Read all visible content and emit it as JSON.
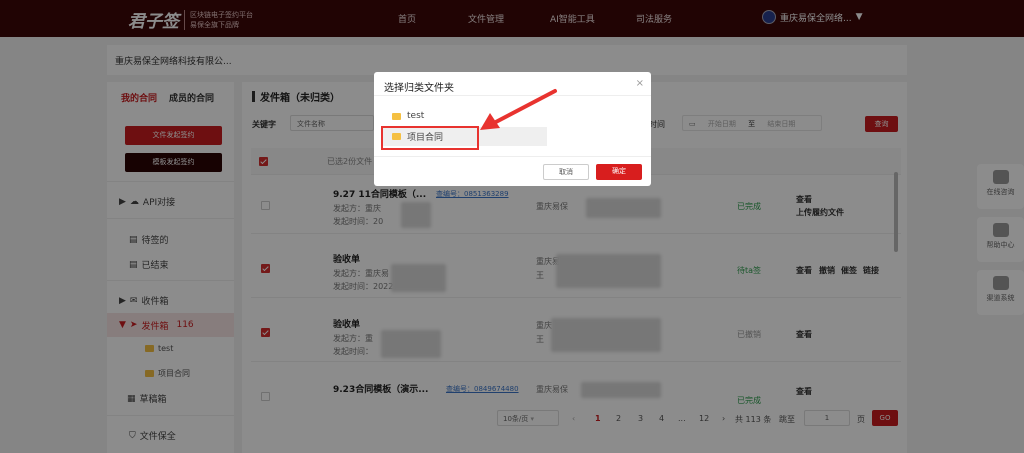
{
  "topbar": {
    "logo_text": "君子签",
    "logo_sub1": "区块链电子签约平台",
    "logo_sub2": "易保全旗下品牌",
    "nav": [
      "首页",
      "文件管理",
      "AI智能工具",
      "司法服务"
    ],
    "account_name": "重庆易保全网络...",
    "dropdown_icon": "chevron-down-icon"
  },
  "company_tab": "重庆易保全网络科技有限公...",
  "sidebar": {
    "tabs": [
      "我的合同",
      "成员的合同"
    ],
    "btn_launch": "文件发起签约",
    "btn_template": "模板发起签约",
    "items": {
      "api": "API对接",
      "pending": "待签的",
      "ended": "已结束",
      "inbox": "收件箱",
      "outbox": "发件箱",
      "outbox_count": "116",
      "sub_test": "test",
      "sub_project": "项目合同",
      "drafts": "草稿箱",
      "preserve": "文件保全"
    }
  },
  "main": {
    "title": "发件箱（未归类）",
    "filter_label": "关键字",
    "filter_select": "文件名称",
    "time_label": "时间",
    "start_date": "开始日期",
    "to": "至",
    "end_date": "结束日期",
    "query_btn": "查询",
    "selected_text": "已选2份文件",
    "rows": [
      {
        "title": "9.27 11合同模板（...",
        "contract_no": "查编号：0851363289",
        "sender": "发起方：重庆",
        "time": "发起时间：20",
        "company": "重庆易保",
        "status": "已完成",
        "status_color": "#2e9d4e",
        "op1": "查看",
        "op2": "上传履约文件"
      },
      {
        "title": "验收单",
        "contract_no": "",
        "sender": "发起方：重庆易",
        "time": "发起时间：2022-",
        "company": "重庆易",
        "company2": "王",
        "status": "待ta签",
        "status_color": "#2e9d4e",
        "op1": "查看",
        "op2": "撤销",
        "op3": "催签",
        "op4": "链接"
      },
      {
        "title": "验收单",
        "contract_no": "",
        "sender": "发起方：重",
        "time": "发起时间：",
        "company": "重庆",
        "company2": "王",
        "status": "已撤销",
        "status_color": "#999999",
        "op1": "查看"
      },
      {
        "title": "9.23合同模板（演示...",
        "contract_no": "查编号：0849674480",
        "sender": "",
        "time": "",
        "company": "重庆易保",
        "status": "已完成",
        "status_color": "#2e9d4e",
        "op1": "查看"
      }
    ]
  },
  "pager": {
    "page_size": "10条/页",
    "pages": [
      "1",
      "2",
      "3",
      "4",
      "...",
      "12"
    ],
    "total": "共 113 条",
    "goto": "跳至",
    "page_input": "1",
    "page_unit": "页",
    "go": "GO"
  },
  "float_panel": {
    "online": "在线咨询",
    "help": "帮助中心",
    "channel": "渠道系统"
  },
  "modal": {
    "title": "选择归类文件夹",
    "close": "×",
    "folders": [
      "test",
      "项目合同"
    ],
    "cancel": "取消",
    "confirm": "确定"
  },
  "colors": {
    "brand": "#3d0809",
    "accent": "#c81d1f",
    "annotation": "#e8332f"
  }
}
